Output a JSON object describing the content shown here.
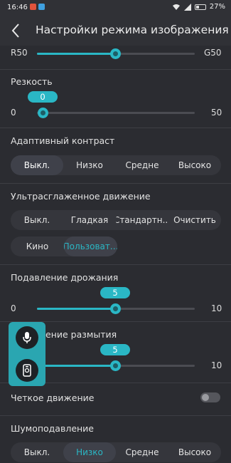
{
  "status": {
    "time": "16:46",
    "battery": "27%"
  },
  "header": {
    "title": "Настройки режима изображения"
  },
  "tint": {
    "left": "R50",
    "right": "G50",
    "fraction": 0.5
  },
  "sharpness": {
    "label": "Резкость",
    "value": "0",
    "min": "0",
    "max": "50",
    "fraction": 0.0
  },
  "adaptive_contrast": {
    "label": "Адаптивный контраст",
    "options": [
      "Выкл.",
      "Низко",
      "Средне",
      "Высоко"
    ],
    "selected": 0
  },
  "motion": {
    "label": "Ультрасглаженное движение",
    "options_row1": [
      "Выкл.",
      "Гладкая",
      "Стандартн...",
      "Очистить"
    ],
    "options_row2": [
      "Кино",
      "Пользоват..."
    ],
    "selected_row2": 1
  },
  "judder": {
    "label": "Подавление дрожания",
    "value": "5",
    "min": "0",
    "max": "10",
    "fraction": 0.5
  },
  "blur": {
    "label": "Подавление размытия",
    "label_visible": "ение размытия",
    "value": "5",
    "max": "10",
    "fraction": 0.5
  },
  "clear_motion": {
    "label": "Четкое движение",
    "enabled": false
  },
  "noise": {
    "label": "Шумоподавление",
    "options": [
      "Выкл.",
      "Низко",
      "Средне",
      "Высоко"
    ],
    "selected": 1
  },
  "colors": {
    "accent": "#2ab7c5",
    "background": "#2b2c31"
  }
}
